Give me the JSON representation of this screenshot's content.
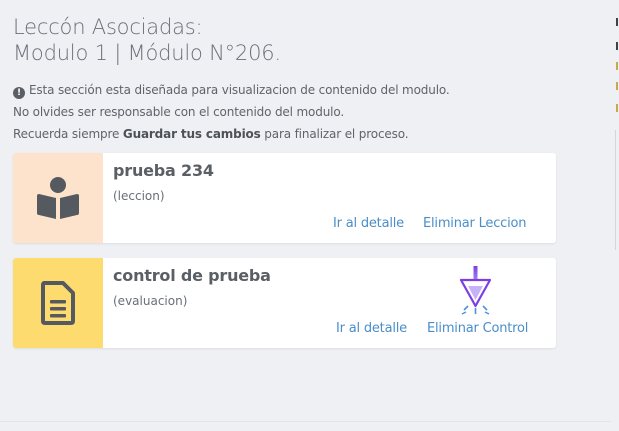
{
  "header": {
    "line1": "Leccón Asociadas:",
    "line2": "Modulo 1 | Módulo N°206."
  },
  "info": {
    "line1": "Esta sección esta diseñada para visualizacion de contenido del modulo.",
    "line2": "No olvides ser responsable con el contenido del modulo.",
    "line3_prefix": "Recuerda siempre ",
    "line3_bold": "Guardar tus cambios",
    "line3_suffix": " para finalizar el proceso."
  },
  "cards": [
    {
      "title": "prueba 234",
      "type": "(leccion)",
      "detail_link": "Ir al detalle",
      "delete_link": "Eliminar Leccion",
      "icon": "book-reader-icon",
      "accent": "#fde3cc"
    },
    {
      "title": "control de prueba",
      "type": "(evaluacion)",
      "detail_link": "Ir al detalle",
      "delete_link": "Eliminar Control",
      "icon": "document-icon",
      "accent": "#fedb6e"
    }
  ],
  "colors": {
    "background": "#eef0f4",
    "link": "#4a8ec9",
    "cursor": "#7b3fe4"
  }
}
